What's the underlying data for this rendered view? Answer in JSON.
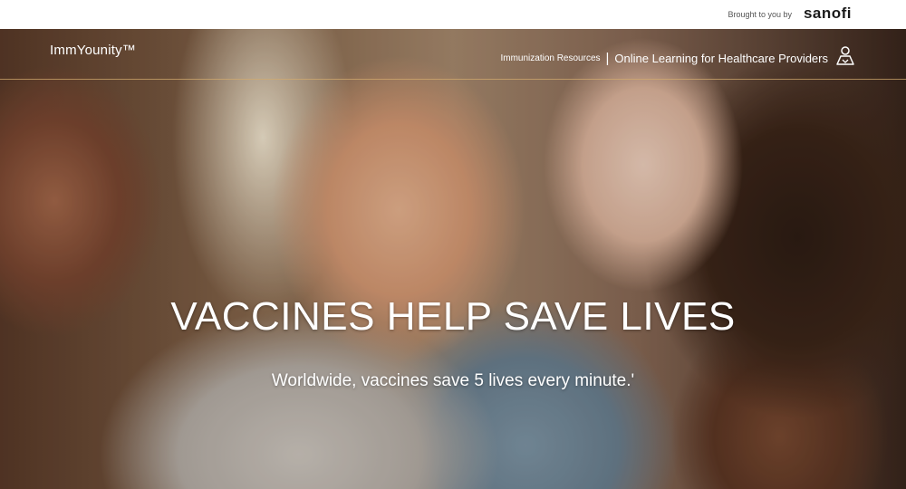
{
  "topbar": {
    "brought_text": "Brought to you by",
    "brand": "sanofi"
  },
  "nav": {
    "logo": "ImmYounity™",
    "immunization_resources": "Immunization Resources",
    "separator": "|",
    "online_learning": "Online Learning for Healthcare Providers",
    "account_icon": "person-icon"
  },
  "hero": {
    "headline": "VACCINES HELP SAVE LIVES",
    "subline": "Worldwide, vaccines save 5 lives every minute.'"
  },
  "colors": {
    "text_on_image": "#ffffff",
    "nav_rule": "#d2aa6e",
    "brand_text": "#1a1a1a"
  }
}
